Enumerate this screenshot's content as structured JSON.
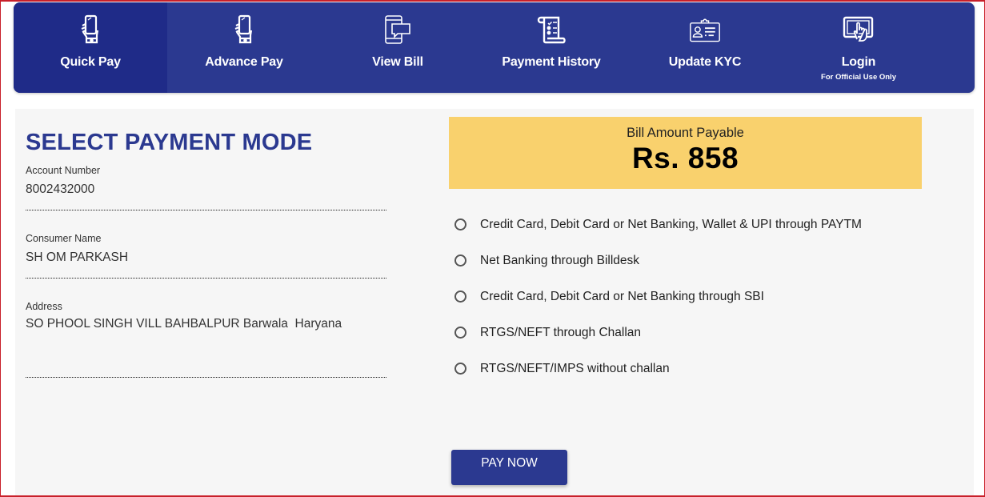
{
  "nav": {
    "items": [
      {
        "label": "Quick Pay",
        "icon": "hand-phone-icon",
        "active": true
      },
      {
        "label": "Advance Pay",
        "icon": "hand-phone-icon",
        "active": false
      },
      {
        "label": "View Bill",
        "icon": "phone-message-icon",
        "active": false
      },
      {
        "label": "Payment History",
        "icon": "receipt-scroll-icon",
        "active": false
      },
      {
        "label": "Update KYC",
        "icon": "id-card-icon",
        "active": false
      },
      {
        "label": "Login",
        "sublabel": "For Official Use Only",
        "icon": "tablet-touch-icon",
        "active": false
      }
    ]
  },
  "main": {
    "title": "SELECT PAYMENT MODE",
    "fields": {
      "account_number": {
        "label": "Account Number",
        "value": "8002432000"
      },
      "consumer_name": {
        "label": "Consumer Name",
        "value": "SH OM PARKASH"
      },
      "address": {
        "label": "Address",
        "value": "SO PHOOL SINGH VILL BAHBALPUR Barwala  Haryana"
      }
    },
    "bill": {
      "label": "Bill Amount Payable",
      "amount": "Rs. 858"
    },
    "payment_options": [
      {
        "label": "Credit Card, Debit Card or Net Banking, Wallet & UPI through PAYTM",
        "selected": false
      },
      {
        "label": "Net Banking through Billdesk",
        "selected": false
      },
      {
        "label": "Credit Card, Debit Card or Net Banking through SBI",
        "selected": false
      },
      {
        "label": "RTGS/NEFT through Challan",
        "selected": false
      },
      {
        "label": "RTGS/NEFT/IMPS without challan",
        "selected": false
      }
    ],
    "pay_button": "PAY NOW"
  },
  "colors": {
    "nav_bg": "#2b3990",
    "nav_active_bg": "#1f2b88",
    "title": "#2b3990",
    "amount_box": "#f9d16d",
    "button": "#2b3990"
  }
}
